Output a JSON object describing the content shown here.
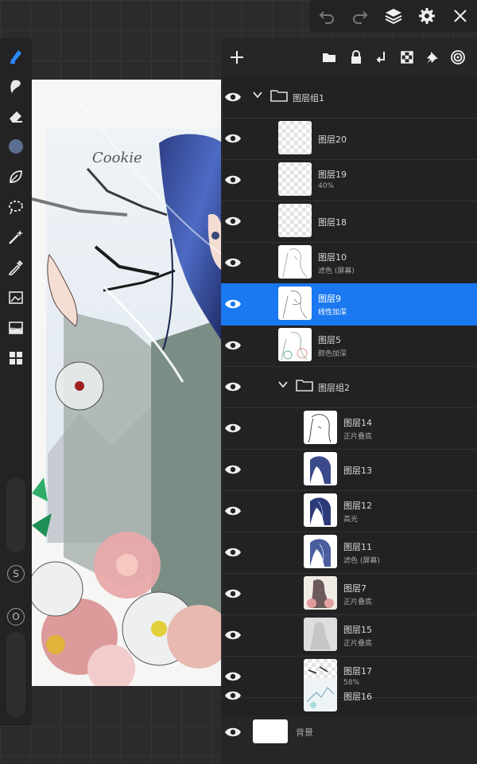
{
  "topbar": {
    "icons": [
      "undo-icon",
      "redo-icon",
      "layers-icon",
      "settings-gear-icon",
      "close-icon"
    ]
  },
  "tools": [
    "brush-icon",
    "smudge-icon",
    "eraser-icon",
    "color-swatch",
    "leaf-icon",
    "lasso-icon",
    "magic-wand-icon",
    "eyedropper-icon",
    "image-transform-icon",
    "filter-icon",
    "gallery-grid-icon"
  ],
  "side_buttons": {
    "s_label": "S",
    "o_label": "O"
  },
  "canvas": {
    "signature_text": "Cookie"
  },
  "layers_panel": {
    "header_icons": [
      "add-layer-icon",
      "folder-icon",
      "lock-icon",
      "merge-down-icon",
      "checker-icon",
      "pin-icon",
      "target-icon"
    ],
    "group1": {
      "name": "图层组1"
    },
    "group2": {
      "name": "图层组2"
    },
    "layers": [
      {
        "name": "图层20",
        "sub": ""
      },
      {
        "name": "图层19",
        "sub": "40%"
      },
      {
        "name": "图层18",
        "sub": ""
      },
      {
        "name": "图层10",
        "sub": "滤色 (屏幕)"
      },
      {
        "name": "图层9",
        "sub": "线性加深"
      },
      {
        "name": "图层5",
        "sub": "颜色加深"
      },
      {
        "name": "图层14",
        "sub": "正片叠底"
      },
      {
        "name": "图层13",
        "sub": ""
      },
      {
        "name": "图层12",
        "sub": "高光"
      },
      {
        "name": "图层11",
        "sub": "滤色 (屏幕)"
      },
      {
        "name": "图层7",
        "sub": "正片叠底"
      },
      {
        "name": "图层15",
        "sub": "正片叠底"
      },
      {
        "name": "图层17",
        "sub": "58%"
      },
      {
        "name": "图层16",
        "sub": ""
      }
    ],
    "background": {
      "name": "背景"
    }
  },
  "colors": {
    "accent": "#1a78f0",
    "panel": "#222224",
    "current_color": "#5c6e90"
  }
}
